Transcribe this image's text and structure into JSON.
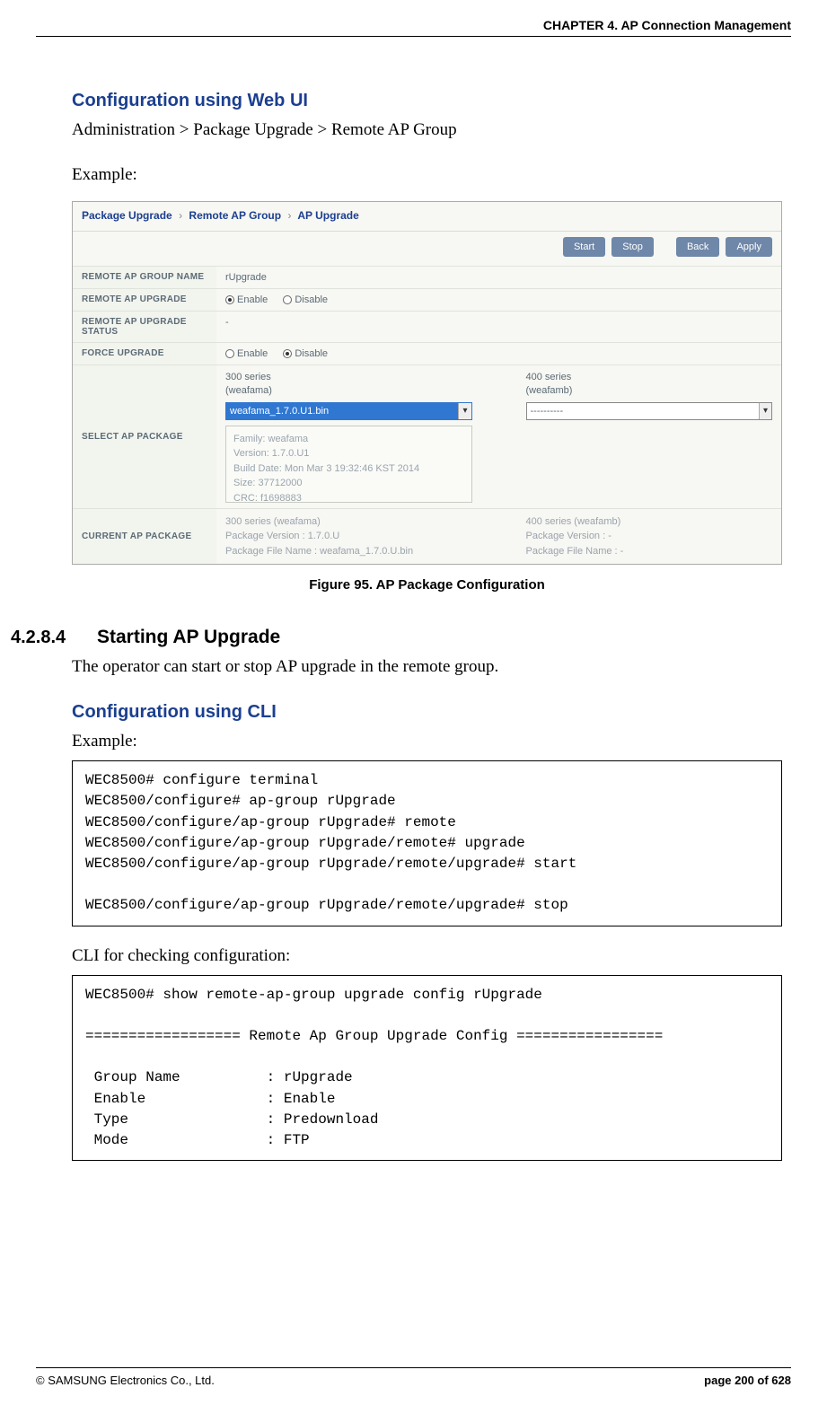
{
  "header": {
    "chapter": "CHAPTER 4. AP Connection Management"
  },
  "sec1": {
    "title": "Configuration using Web UI",
    "breadcrumb": "Administration > Package Upgrade > Remote AP Group",
    "example_label": "Example:"
  },
  "sshot": {
    "crumb": {
      "a": "Package Upgrade",
      "b": "Remote AP Group",
      "c": "AP Upgrade"
    },
    "btn_start": "Start",
    "btn_stop": "Stop",
    "btn_back": "Back",
    "btn_apply": "Apply",
    "rows": {
      "name_lbl": "REMOTE AP GROUP NAME",
      "name_val": "rUpgrade",
      "upgrade_lbl": "REMOTE AP UPGRADE",
      "enable": "Enable",
      "disable": "Disable",
      "status_lbl": "REMOTE AP UPGRADE STATUS",
      "status_val": "-",
      "force_lbl": "FORCE UPGRADE",
      "select_lbl": "SELECT AP PACKAGE",
      "curr_lbl": "CURRENT AP PACKAGE"
    },
    "col300": {
      "hdr1": "300 series",
      "hdr2": "(weafama)",
      "dd": "weafama_1.7.0.U1.bin",
      "info": "Family: weafama\nVersion: 1.7.0.U1\nBuild Date: Mon Mar 3 19:32:46 KST 2014\nSize: 37712000\nCRC: f1698883",
      "cur1": "300 series (weafama)",
      "cur2": "Package Version : 1.7.0.U",
      "cur3": "Package File Name : weafama_1.7.0.U.bin"
    },
    "col400": {
      "hdr1": "400 series",
      "hdr2": "(weafamb)",
      "dd": "----------",
      "cur1": "400 series (weafamb)",
      "cur2": "Package Version : -",
      "cur3": "Package File Name : -"
    }
  },
  "fig": {
    "caption": "Figure 95. AP Package Configuration"
  },
  "sec2": {
    "num": "4.2.8.4",
    "title": "Starting AP Upgrade",
    "desc": "The operator can start or stop AP upgrade in the remote group."
  },
  "sec3": {
    "title": "Configuration using CLI",
    "example_label": "Example:",
    "code": "WEC8500# configure terminal\nWEC8500/configure# ap-group rUpgrade\nWEC8500/configure/ap-group rUpgrade# remote\nWEC8500/configure/ap-group rUpgrade/remote# upgrade\nWEC8500/configure/ap-group rUpgrade/remote/upgrade# start\n\nWEC8500/configure/ap-group rUpgrade/remote/upgrade# stop",
    "check_label": "CLI for checking configuration:",
    "code2": "WEC8500# show remote-ap-group upgrade config rUpgrade\n\n================== Remote Ap Group Upgrade Config =================\n\n Group Name          : rUpgrade\n Enable              : Enable\n Type                : Predownload\n Mode                : FTP"
  },
  "footer": {
    "copyright": "© SAMSUNG Electronics Co., Ltd.",
    "page": "page 200 of 628"
  }
}
